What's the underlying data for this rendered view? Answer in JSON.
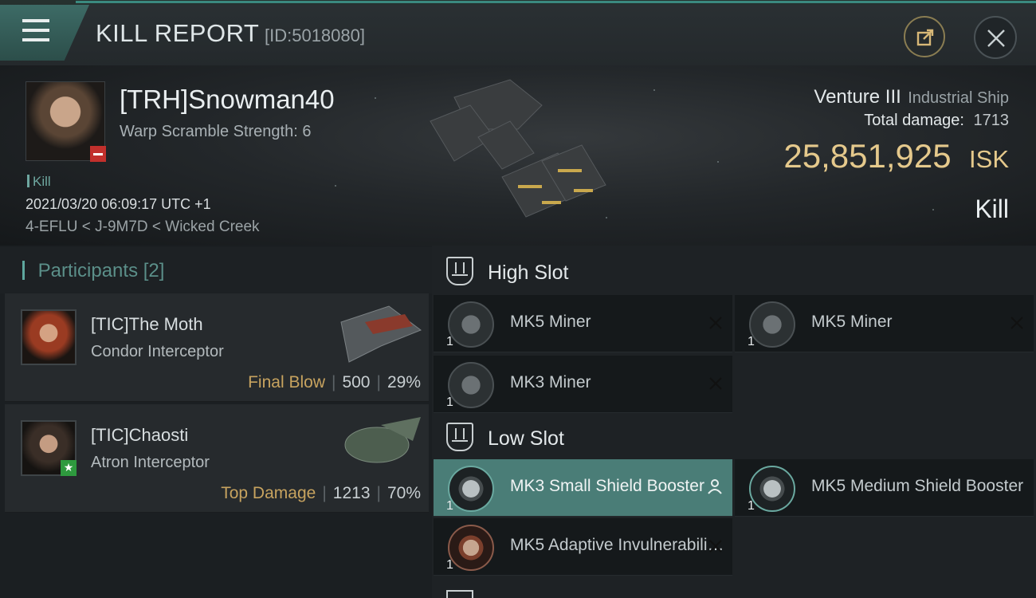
{
  "header": {
    "title": "KILL REPORT",
    "report_id": "[ID:5018080]"
  },
  "victim": {
    "name": "[TRH]Snowman40",
    "warp_scramble": "Warp Scramble Strength: 6",
    "kill_tag": "Kill",
    "timestamp": "2021/03/20 06:09:17 UTC +1",
    "location": "4-EFLU < J-9M7D < Wicked Creek"
  },
  "ship": {
    "name": "Venture III",
    "class": "Industrial Ship",
    "total_damage_label": "Total damage:",
    "total_damage": "1713",
    "isk_amount": "25,851,925",
    "isk_unit": "ISK",
    "result": "Kill"
  },
  "participants": {
    "label": "Participants",
    "count": "[2]",
    "items": [
      {
        "name": "[TIC]The Moth",
        "ship": "Condor Interceptor",
        "tag": "Final Blow",
        "damage": "500",
        "percent": "29%"
      },
      {
        "name": "[TIC]Chaosti",
        "ship": "Atron Interceptor",
        "tag": "Top Damage",
        "damage": "1213",
        "percent": "70%"
      }
    ]
  },
  "slots": {
    "high": {
      "label": "High Slot",
      "modules": [
        {
          "name": "MK5 Miner",
          "qty": "1"
        },
        {
          "name": "MK5 Miner",
          "qty": "1"
        },
        {
          "name": "MK3 Miner",
          "qty": "1"
        }
      ]
    },
    "low": {
      "label": "Low Slot",
      "modules": [
        {
          "name": "MK3 Small Shield Booster",
          "qty": "1"
        },
        {
          "name": "MK5 Medium Shield Booster",
          "qty": "1"
        },
        {
          "name": "MK5 Adaptive Invulnerabilit...",
          "qty": "1"
        }
      ]
    }
  },
  "colors": {
    "accent": "#3a8a7f",
    "isk_gold": "#e5c98c",
    "selected_row": "#4a7d77",
    "loss_badge": "#c2302c"
  }
}
